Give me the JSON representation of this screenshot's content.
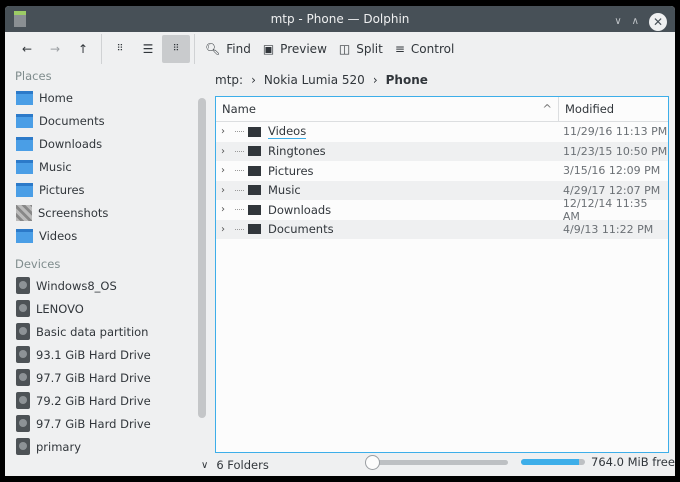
{
  "window": {
    "title": "mtp - Phone — Dolphin"
  },
  "toolbar": {
    "find": "Find",
    "preview": "Preview",
    "split": "Split",
    "control": "Control"
  },
  "sidebar": {
    "places_header": "Places",
    "places": [
      {
        "label": "Home",
        "icon": "home-folder-icon"
      },
      {
        "label": "Documents",
        "icon": "folder-icon"
      },
      {
        "label": "Downloads",
        "icon": "folder-icon"
      },
      {
        "label": "Music",
        "icon": "folder-icon"
      },
      {
        "label": "Pictures",
        "icon": "folder-icon"
      },
      {
        "label": "Screenshots",
        "icon": "screenshots-icon"
      },
      {
        "label": "Videos",
        "icon": "folder-icon"
      }
    ],
    "devices_header": "Devices",
    "devices": [
      "Windows8_OS",
      "LENOVO",
      "Basic data partition",
      "93.1 GiB Hard Drive",
      "97.7 GiB Hard Drive",
      "79.2 GiB Hard Drive",
      "97.7 GiB Hard Drive",
      "primary"
    ]
  },
  "breadcrumb": [
    "mtp:",
    "Nokia Lumia 520",
    "Phone"
  ],
  "table": {
    "columns": [
      "Name",
      "Modified"
    ],
    "rows": [
      {
        "name": "Videos",
        "modified": "11/29/16 11:13 PM"
      },
      {
        "name": "Ringtones",
        "modified": "11/23/15 10:50 PM"
      },
      {
        "name": "Pictures",
        "modified": "3/15/16 12:09 PM"
      },
      {
        "name": "Music",
        "modified": "4/29/17 12:07 PM"
      },
      {
        "name": "Downloads",
        "modified": "12/12/14 11:35 AM"
      },
      {
        "name": "Documents",
        "modified": "4/9/13 11:22 PM"
      }
    ]
  },
  "status": {
    "count": "6 Folders",
    "free": "764.0 MiB free",
    "capacity_used_percent": 90,
    "zoom_percent": 0
  },
  "colors": {
    "accent": "#3daee9",
    "titlebar": "#475057"
  }
}
